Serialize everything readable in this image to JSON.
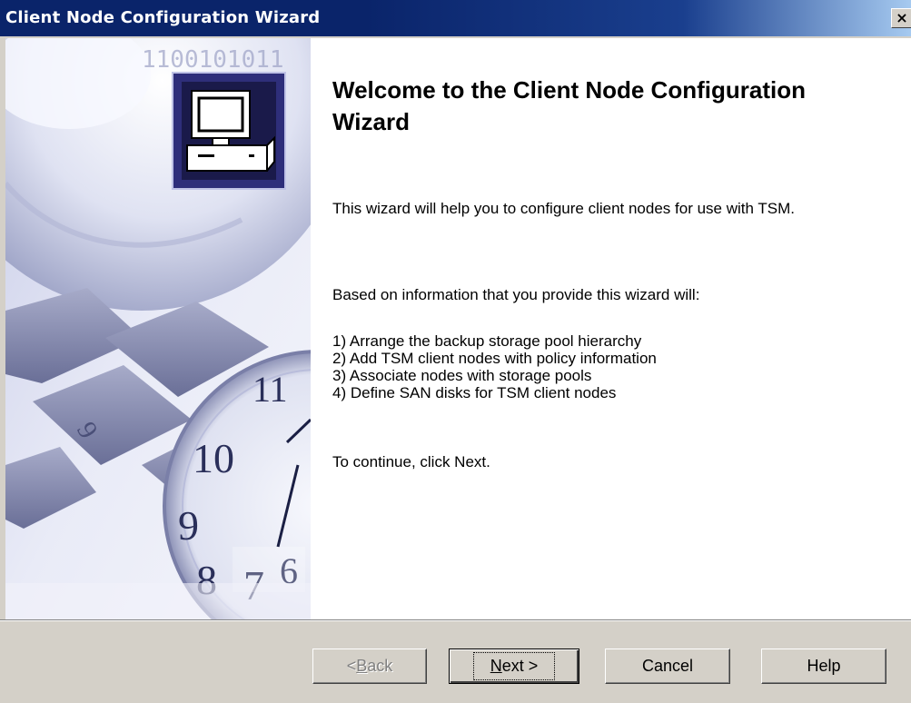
{
  "window": {
    "title": "Client Node Configuration Wizard",
    "close_glyph": "×"
  },
  "banner": {
    "binary_text": "1100101011",
    "icon": "computer-icon",
    "clock_numbers": [
      "11",
      "10",
      "9",
      "8",
      "7",
      "6"
    ]
  },
  "content": {
    "heading": "Welcome to the Client Node Configuration Wizard",
    "intro": "This wizard will help you to configure client nodes for use with TSM.",
    "based_on": "Based on information that you provide this wizard will:",
    "steps": [
      "1) Arrange the backup storage pool hierarchy",
      "2) Add TSM client nodes with policy information",
      "3) Associate nodes with storage pools",
      "4) Define SAN disks for TSM client nodes"
    ],
    "continue": "To continue, click Next."
  },
  "buttons": {
    "back": {
      "prefix": "< ",
      "mnemonic": "B",
      "rest": "ack",
      "enabled": false
    },
    "next": {
      "mnemonic": "N",
      "rest": "ext >",
      "enabled": true
    },
    "cancel": {
      "label": "Cancel",
      "enabled": true
    },
    "help": {
      "label": "Help",
      "enabled": true
    }
  },
  "colors": {
    "titlebar": "#0a246a",
    "dialog_face": "#d4d0c8",
    "icon_border": "#2e2e7a",
    "icon_background": "#1a1a4a"
  }
}
